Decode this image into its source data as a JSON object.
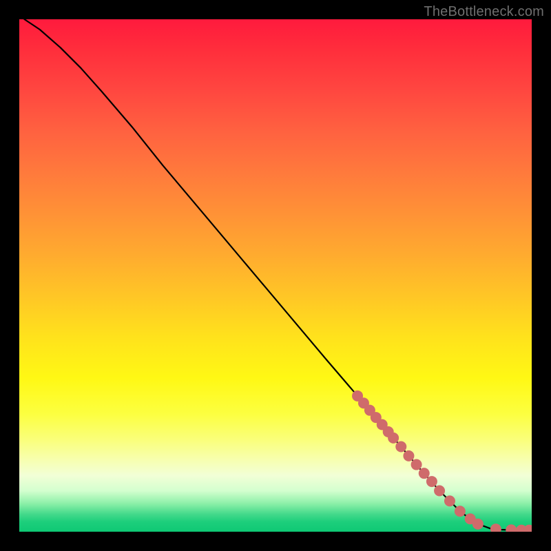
{
  "watermark": "TheBottleneck.com",
  "chart_data": {
    "type": "line",
    "title": "",
    "xlabel": "",
    "ylabel": "",
    "xlim": [
      0,
      100
    ],
    "ylim": [
      0,
      100
    ],
    "grid": false,
    "legend": false,
    "series": [
      {
        "name": "curve",
        "kind": "line",
        "color": "#000000",
        "x": [
          1,
          4,
          8,
          12,
          16,
          22,
          28,
          36,
          44,
          52,
          60,
          66,
          72,
          78,
          82,
          86,
          89,
          92,
          94,
          95.5,
          97,
          98.5,
          99.5
        ],
        "y": [
          100,
          98,
          94.5,
          90.5,
          86,
          79,
          71.5,
          62,
          52.5,
          43,
          33.5,
          26.5,
          19.5,
          12.5,
          8,
          4,
          1.7,
          0.6,
          0.4,
          0.35,
          0.3,
          0.3,
          0.3
        ]
      },
      {
        "name": "points",
        "kind": "scatter",
        "color": "#cf6b6b",
        "x": [
          66,
          67.2,
          68.4,
          69.6,
          70.8,
          72.0,
          73.0,
          74.5,
          76.0,
          77.5,
          79.0,
          80.5,
          82.0,
          84.0,
          86.0,
          88.0,
          89.5,
          93.0,
          96.0,
          98.0,
          99.5
        ],
        "y": [
          26.5,
          25.1,
          23.7,
          22.3,
          20.9,
          19.5,
          18.3,
          16.6,
          14.8,
          13.1,
          11.4,
          9.8,
          8.0,
          6.0,
          4.0,
          2.5,
          1.5,
          0.5,
          0.35,
          0.3,
          0.3
        ]
      }
    ]
  }
}
